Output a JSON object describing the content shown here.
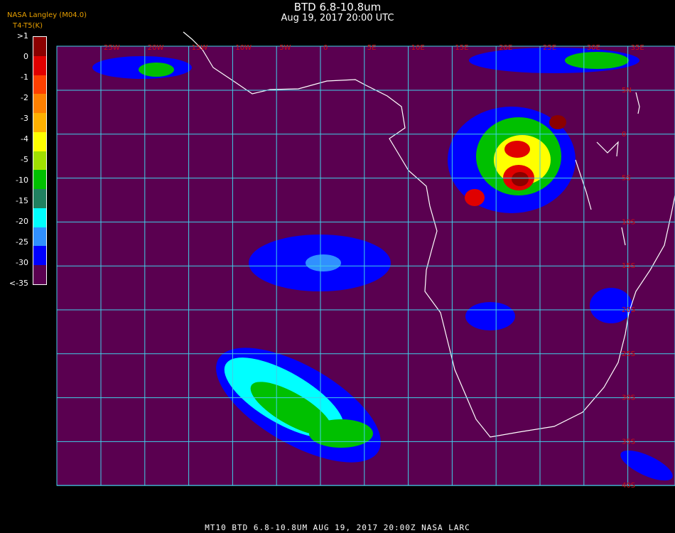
{
  "header": {
    "title": "BTD 6.8-10.8um",
    "subtitle": "Aug 19, 2017 20:00 UTC",
    "credit": "NASA Langley (M04.0)",
    "units": "T4-T5(K)"
  },
  "colorbar": {
    "labels": [
      ">1",
      "0",
      "-1",
      "-2",
      "-3",
      "-4",
      "-5",
      "-10",
      "-15",
      "-20",
      "-25",
      "-30",
      "<-35"
    ],
    "colors": [
      "#8b0000",
      "#e00000",
      "#ff4000",
      "#ff8000",
      "#ffb000",
      "#ffff00",
      "#a0e000",
      "#00c000",
      "#208060",
      "#00ffff",
      "#3090ff",
      "#0000ff",
      "#5a0050"
    ]
  },
  "map": {
    "background_color": "#5a0050",
    "grid_color": "#40d0e8",
    "coast_color": "#ffffff",
    "label_color": "#d01010",
    "lon_labels": [
      "25W",
      "20W",
      "15W",
      "10W",
      "5W",
      "0",
      "5E",
      "10E",
      "15E",
      "20E",
      "25E",
      "30E",
      "35E"
    ],
    "lat_labels": [
      "5N",
      "0",
      "5S",
      "10S",
      "15S",
      "20S",
      "25S",
      "30S",
      "35S",
      "40S"
    ]
  },
  "footer": {
    "text": "MT10  BTD 6.8-10.8UM   AUG 19, 2017 20:00Z   NASA LARC"
  }
}
